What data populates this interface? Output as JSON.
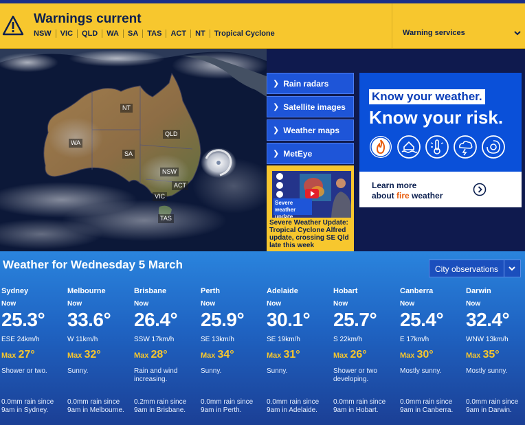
{
  "warnings": {
    "title": "Warnings current",
    "states": [
      "NSW",
      "VIC",
      "QLD",
      "WA",
      "SA",
      "TAS",
      "ACT",
      "NT",
      "Tropical Cyclone"
    ],
    "services_label": "Warning services",
    "icon": "warning-triangle-icon"
  },
  "map": {
    "state_labels": {
      "nt": "NT",
      "qld": "QLD",
      "wa": "WA",
      "sa": "SA",
      "nsw": "NSW",
      "act": "ACT",
      "vic": "VIC",
      "tas": "TAS"
    }
  },
  "nav_links": [
    "Rain radars",
    "Satellite images",
    "Weather maps",
    "MetEye"
  ],
  "video": {
    "thumb_label": "Severe weather update",
    "caption": "Severe Weather Update: Tropical Cyclone Alfred update, crossing SE Qld late this week"
  },
  "ad": {
    "line1": "Know your weather.",
    "line2": "Know your risk.",
    "learn_prefix": "Learn more",
    "learn_about": "about ",
    "learn_fire": "fire",
    "learn_suffix": " weather",
    "icons": [
      "fire-icon",
      "flood-icon",
      "heat-icon",
      "storm-icon",
      "cyclone-icon"
    ]
  },
  "weather": {
    "title": "Weather for Wednesday 5 March",
    "select_value": "City observations",
    "now_label": "Now",
    "max_label": "Max",
    "cities": [
      {
        "name": "Sydney",
        "temp": "25.3°",
        "wind": "ESE 24km/h",
        "max": "27°",
        "desc": "Shower or two.",
        "rain": "0.0mm rain since 9am in Sydney."
      },
      {
        "name": "Melbourne",
        "temp": "33.6°",
        "wind": "W 11km/h",
        "max": "32°",
        "desc": "Sunny.",
        "rain": "0.0mm rain since 9am in Melbourne."
      },
      {
        "name": "Brisbane",
        "temp": "26.4°",
        "wind": "SSW 17km/h",
        "max": "28°",
        "desc": "Rain and wind increasing.",
        "rain": "0.2mm rain since 9am in Brisbane."
      },
      {
        "name": "Perth",
        "temp": "25.9°",
        "wind": "SE 13km/h",
        "max": "34°",
        "desc": "Sunny.",
        "rain": "0.0mm rain since 9am in Perth."
      },
      {
        "name": "Adelaide",
        "temp": "30.1°",
        "wind": "SE 19km/h",
        "max": "31°",
        "desc": "Sunny.",
        "rain": "0.0mm rain since 9am in Adelaide."
      },
      {
        "name": "Hobart",
        "temp": "25.7°",
        "wind": "S 22km/h",
        "max": "26°",
        "desc": "Shower or two developing.",
        "rain": "0.0mm rain since 9am in Hobart."
      },
      {
        "name": "Canberra",
        "temp": "25.4°",
        "wind": "E 17km/h",
        "max": "30°",
        "desc": "Mostly sunny.",
        "rain": "0.0mm rain since 9am in Canberra."
      },
      {
        "name": "Darwin",
        "temp": "32.4°",
        "wind": "WNW 13km/h",
        "max": "35°",
        "desc": "Mostly sunny.",
        "rain": "0.0mm rain since 9am in Darwin."
      }
    ]
  },
  "colors": {
    "warning_yellow": "#f7c72e",
    "navy": "#0b1f4f",
    "link_blue": "#1e55d8",
    "max_yellow": "#f7c72e",
    "fire_orange": "#e85c0d"
  }
}
